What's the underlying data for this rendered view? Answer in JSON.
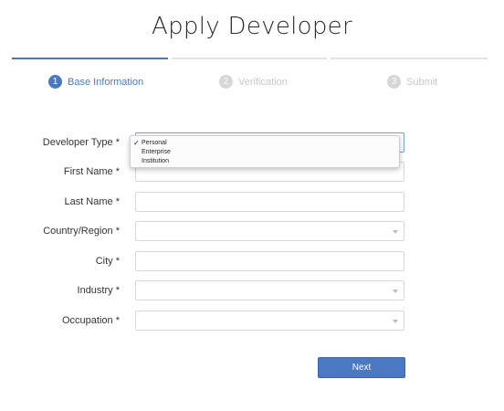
{
  "page": {
    "title": "Apply Developer"
  },
  "steps": [
    {
      "number": "1",
      "label": "Base Information",
      "state": "active"
    },
    {
      "number": "2",
      "label": "Verification",
      "state": "inactive"
    },
    {
      "number": "3",
      "label": "Submit",
      "state": "inactive"
    }
  ],
  "form": {
    "required_mark": "*",
    "fields": [
      {
        "label": "Developer Type",
        "type": "select",
        "value": "Personal"
      },
      {
        "label": "First Name",
        "type": "text",
        "value": ""
      },
      {
        "label": "Last Name",
        "type": "text",
        "value": ""
      },
      {
        "label": "Country/Region",
        "type": "select",
        "value": ""
      },
      {
        "label": "City",
        "type": "text",
        "value": ""
      },
      {
        "label": "Industry",
        "type": "select",
        "value": ""
      },
      {
        "label": "Occupation",
        "type": "select",
        "value": ""
      }
    ]
  },
  "dropdown": {
    "options": [
      "Personal",
      "Enterprise",
      "Institution"
    ],
    "selected": "Personal",
    "check_mark": "✓"
  },
  "actions": {
    "next_label": "Next"
  },
  "colors": {
    "accent": "#4a78c2",
    "inactive": "#d6d6d6"
  }
}
